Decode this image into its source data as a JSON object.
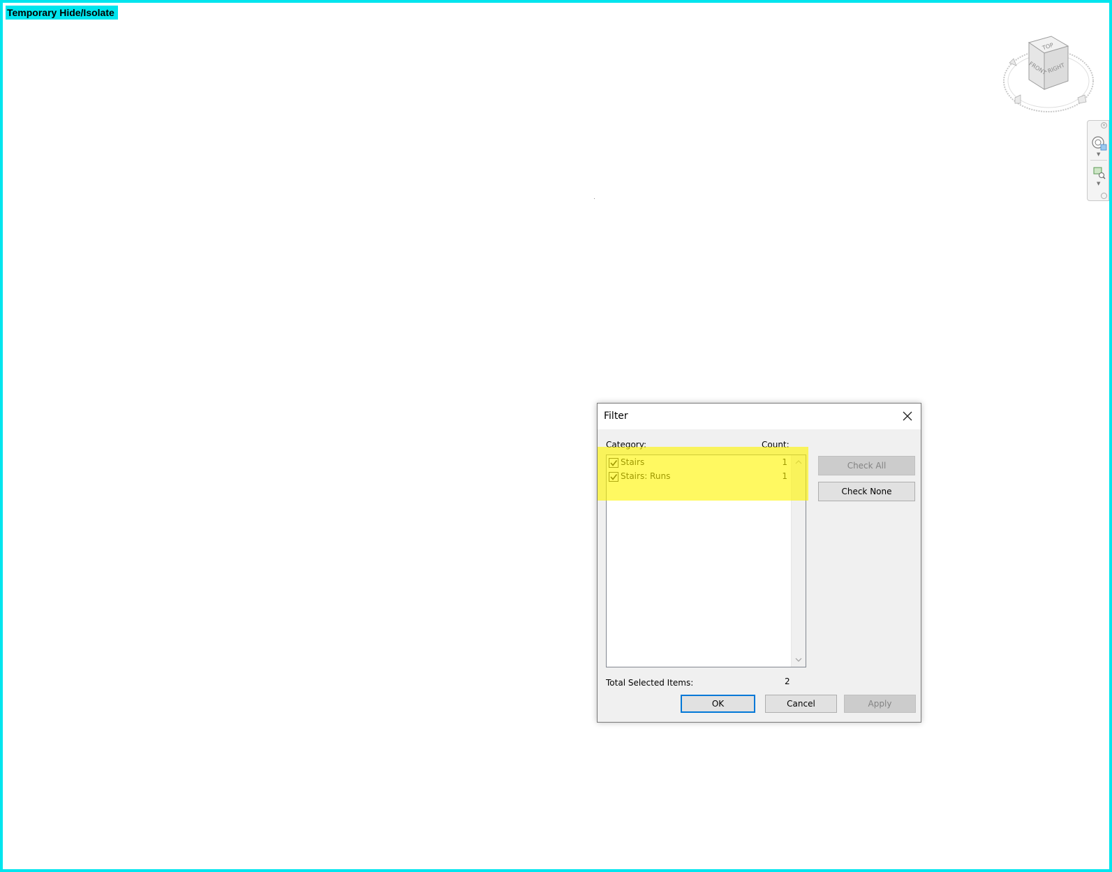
{
  "canvas": {
    "mode_label": "Temporary Hide/Isolate",
    "border_color": "#00e5ee"
  },
  "viewcube": {
    "faces": {
      "top": "TOP",
      "front": "FRONT",
      "right": "RIGHT"
    }
  },
  "navigation_bar": {
    "tools": [
      "full-navigation-wheel-icon",
      "zoom-region-icon"
    ]
  },
  "filter_dialog": {
    "title": "Filter",
    "category_header": "Category:",
    "count_header": "Count:",
    "items": [
      {
        "name": "Stairs",
        "count": "1",
        "checked": true
      },
      {
        "name": "Stairs: Runs",
        "count": "1",
        "checked": true
      }
    ],
    "buttons": {
      "check_all": "Check All",
      "check_none": "Check None",
      "ok": "OK",
      "cancel": "Cancel",
      "apply": "Apply"
    },
    "total_label": "Total Selected Items:",
    "total_value": "2",
    "highlight_color": "#fff200"
  }
}
